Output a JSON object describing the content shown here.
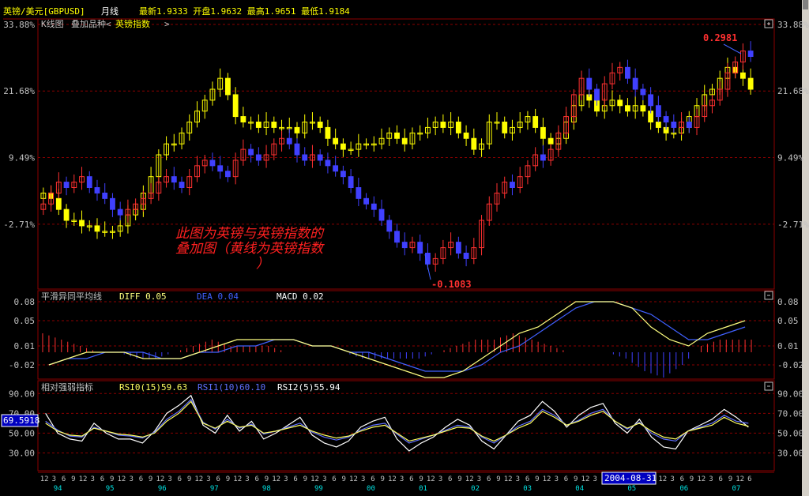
{
  "header": {
    "symbol": "英镑/美元[GBPUSD]",
    "period": "月线",
    "quote": "最新1.9333  开盘1.9632  最高1.9651  最低1.9184"
  },
  "main_panel": {
    "title": "K线图",
    "overlay_label": "叠加品种<",
    "overlay_name": "英镑指数",
    "overlay_suffix": ">",
    "high_label": "0.2981",
    "low_label": "-0.1083",
    "annotation_lines": [
      "此图为英镑与英镑指数的",
      "叠加图（黄线为英镑指数",
      "）"
    ]
  },
  "macd_panel": {
    "title": "平滑异同平均线",
    "diff_label": "DIFF 0.05",
    "dea_label": "DEA 0.04",
    "macd_label": "MACD 0.02"
  },
  "rsi_panel": {
    "title": "相对强弱指标",
    "rsi0_label": "RSI0(15)59.63",
    "rsi1_label": "RSI1(10)60.10",
    "rsi2_label": "RSI2(5)55.94",
    "value_box": "69.5918"
  },
  "x_axis": {
    "month_row": [
      "12",
      "3",
      "6",
      "9",
      "12",
      "3",
      "6",
      "9",
      "12",
      "3",
      "6",
      "9",
      "12",
      "3",
      "6",
      "9",
      "12",
      "3",
      "6",
      "9",
      "12",
      "3",
      "6",
      "9",
      "12",
      "3",
      "6",
      "9",
      "12",
      "3",
      "6",
      "9",
      "12",
      "3",
      "6",
      "9",
      "12",
      "3",
      "6",
      "9",
      "12",
      "3",
      "6",
      "9",
      "12",
      "3",
      "6",
      "9",
      "12",
      "3",
      "6",
      "9",
      "12",
      "3",
      "6",
      "9",
      "12",
      "3",
      "6",
      "9",
      "12",
      "3",
      "6",
      "9",
      "12",
      "3",
      "6",
      "9",
      "12",
      "3",
      "6",
      "9",
      "12",
      "6"
    ],
    "year_labels": [
      "94",
      "95",
      "96",
      "97",
      "98",
      "99",
      "00",
      "01",
      "02",
      "03",
      "04",
      "05",
      "06",
      "07"
    ],
    "cursor_date": "2004-08-31"
  },
  "colors": {
    "up_candle": "#ff3030",
    "down_candle": "#4040ff",
    "overlay_up": "#ffff00",
    "overlay_down": "#ffff00",
    "grid": "#8b0000",
    "panel_border": "#8b0000",
    "diff_line": "#ffff80",
    "dea_line": "#4060ff",
    "rsi0": "#ffff60",
    "rsi1": "#6070ff",
    "rsi2": "#ffffff",
    "annotation": "#ff2020",
    "year_text": "#00e0e0",
    "axis_text": "#c0c0c0"
  },
  "chart_data": [
    {
      "type": "candlestick",
      "title": "K线图",
      "y_axis_ticks": [
        "33.88%",
        "21.68%",
        "9.49%",
        "-2.71%"
      ],
      "ylim": [
        -0.14,
        0.34
      ],
      "series": [
        {
          "name": "英镑/美元",
          "values": [
            0.01,
            0.03,
            0.05,
            0.04,
            0.05,
            0.06,
            0.04,
            0.03,
            0.02,
            0.0,
            -0.01,
            0.0,
            0.01,
            0.02,
            0.03,
            0.05,
            0.06,
            0.05,
            0.04,
            0.06,
            0.08,
            0.09,
            0.08,
            0.07,
            0.06,
            0.09,
            0.11,
            0.1,
            0.09,
            0.1,
            0.12,
            0.13,
            0.12,
            0.1,
            0.09,
            0.1,
            0.09,
            0.08,
            0.07,
            0.06,
            0.04,
            0.02,
            0.01,
            0.0,
            -0.02,
            -0.04,
            -0.06,
            -0.07,
            -0.06,
            -0.08,
            -0.1,
            -0.09,
            -0.07,
            -0.06,
            -0.08,
            -0.09,
            -0.07,
            -0.02,
            0.01,
            0.03,
            0.05,
            0.04,
            0.06,
            0.08,
            0.1,
            0.09,
            0.11,
            0.14,
            0.17,
            0.21,
            0.24,
            0.22,
            0.2,
            0.23,
            0.25,
            0.26,
            0.24,
            0.22,
            0.21,
            0.19,
            0.17,
            0.16,
            0.15,
            0.16,
            0.15,
            0.17,
            0.19,
            0.2,
            0.22,
            0.25,
            0.27,
            0.29,
            0.28
          ]
        },
        {
          "name": "英镑指数",
          "values": [
            0.03,
            0.02,
            0.0,
            -0.02,
            -0.02,
            -0.03,
            -0.03,
            -0.04,
            -0.04,
            -0.04,
            -0.03,
            -0.01,
            0.0,
            0.03,
            0.06,
            0.1,
            0.12,
            0.12,
            0.14,
            0.16,
            0.18,
            0.2,
            0.22,
            0.24,
            0.21,
            0.17,
            0.16,
            0.16,
            0.15,
            0.16,
            0.15,
            0.15,
            0.15,
            0.14,
            0.16,
            0.16,
            0.15,
            0.13,
            0.12,
            0.11,
            0.11,
            0.12,
            0.12,
            0.12,
            0.13,
            0.14,
            0.13,
            0.12,
            0.14,
            0.14,
            0.15,
            0.16,
            0.15,
            0.16,
            0.14,
            0.13,
            0.11,
            0.12,
            0.16,
            0.16,
            0.14,
            0.15,
            0.16,
            0.17,
            0.15,
            0.13,
            0.12,
            0.13,
            0.16,
            0.19,
            0.21,
            0.2,
            0.18,
            0.19,
            0.2,
            0.19,
            0.18,
            0.19,
            0.18,
            0.16,
            0.15,
            0.14,
            0.14,
            0.15,
            0.17,
            0.19,
            0.21,
            0.22,
            0.24,
            0.26,
            0.25,
            0.24,
            0.22
          ]
        }
      ],
      "annotations": [
        {
          "text": "0.2981",
          "value": 0.2981
        },
        {
          "text": "-0.1083",
          "value": -0.1083
        }
      ]
    },
    {
      "type": "line",
      "title": "平滑异同平均线",
      "y_axis_ticks": [
        "0.08",
        "0.05",
        "0.01",
        "-0.02"
      ],
      "ylim": [
        -0.04,
        0.085
      ],
      "series": [
        {
          "name": "DIFF",
          "values": [
            -0.02,
            -0.01,
            0.0,
            0.0,
            0.0,
            -0.01,
            -0.01,
            -0.01,
            0.0,
            0.01,
            0.02,
            0.02,
            0.02,
            0.02,
            0.01,
            0.01,
            0.0,
            -0.01,
            -0.02,
            -0.03,
            -0.04,
            -0.04,
            -0.03,
            -0.01,
            0.01,
            0.03,
            0.04,
            0.06,
            0.08,
            0.08,
            0.08,
            0.07,
            0.04,
            0.02,
            0.01,
            0.03,
            0.04,
            0.05
          ]
        },
        {
          "name": "DEA",
          "values": [
            -0.02,
            -0.01,
            -0.01,
            0.0,
            0.0,
            0.0,
            -0.01,
            -0.01,
            0.0,
            0.0,
            0.01,
            0.01,
            0.02,
            0.02,
            0.01,
            0.01,
            0.0,
            0.0,
            -0.01,
            -0.02,
            -0.03,
            -0.03,
            -0.03,
            -0.02,
            0.0,
            0.01,
            0.03,
            0.05,
            0.07,
            0.08,
            0.08,
            0.07,
            0.06,
            0.04,
            0.02,
            0.02,
            0.03,
            0.04
          ]
        },
        {
          "name": "MACD",
          "values": [
            0.03,
            0.02,
            0.01,
            0.0,
            0.0,
            -0.01,
            -0.01,
            0.0,
            0.01,
            0.02,
            0.01,
            0.01,
            0.01,
            0.0,
            0.0,
            0.0,
            0.0,
            -0.01,
            -0.01,
            -0.01,
            -0.01,
            0.0,
            0.01,
            0.02,
            0.02,
            0.03,
            0.02,
            0.01,
            0.0,
            0.0,
            0.0,
            -0.01,
            -0.03,
            -0.04,
            -0.02,
            0.01,
            0.02,
            0.02
          ]
        }
      ]
    },
    {
      "type": "line",
      "title": "相对强弱指标",
      "y_axis_ticks": [
        "90.00",
        "70.00",
        "50.00",
        "30.00"
      ],
      "ylim": [
        12,
        95
      ],
      "series": [
        {
          "name": "RSI0",
          "values": [
            60,
            52,
            48,
            47,
            55,
            52,
            49,
            48,
            46,
            50,
            62,
            70,
            82,
            60,
            55,
            62,
            56,
            58,
            50,
            52,
            55,
            58,
            52,
            48,
            45,
            47,
            52,
            56,
            58,
            50,
            42,
            45,
            48,
            52,
            56,
            55,
            47,
            42,
            48,
            55,
            60,
            72,
            66,
            58,
            62,
            68,
            72,
            62,
            55,
            60,
            52,
            46,
            44,
            52,
            55,
            58,
            66,
            60,
            57
          ]
        },
        {
          "name": "RSI1",
          "values": [
            62,
            53,
            47,
            46,
            56,
            52,
            48,
            47,
            45,
            51,
            64,
            72,
            84,
            61,
            54,
            64,
            55,
            59,
            49,
            52,
            56,
            60,
            51,
            46,
            43,
            46,
            53,
            58,
            60,
            49,
            40,
            44,
            48,
            53,
            58,
            56,
            46,
            40,
            48,
            57,
            62,
            74,
            68,
            58,
            63,
            70,
            74,
            62,
            54,
            61,
            50,
            44,
            42,
            52,
            56,
            60,
            68,
            62,
            60
          ]
        },
        {
          "name": "RSI2",
          "values": [
            70,
            50,
            44,
            42,
            60,
            50,
            44,
            44,
            40,
            52,
            70,
            78,
            88,
            58,
            50,
            68,
            52,
            62,
            44,
            50,
            58,
            66,
            48,
            40,
            36,
            42,
            56,
            62,
            66,
            44,
            32,
            40,
            46,
            56,
            64,
            58,
            42,
            34,
            48,
            62,
            68,
            82,
            72,
            56,
            68,
            76,
            80,
            60,
            50,
            64,
            46,
            36,
            34,
            52,
            58,
            64,
            74,
            66,
            56
          ]
        }
      ]
    }
  ]
}
